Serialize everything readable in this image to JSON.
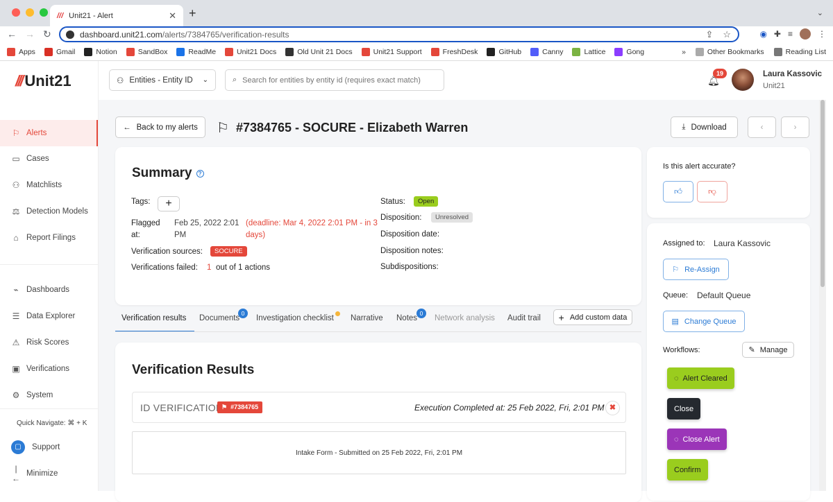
{
  "browser": {
    "tab_title": "Unit21 - Alert",
    "url_host": "dashboard.unit21.com",
    "url_path": "/alerts/7384765/verification-results",
    "bookmarks": [
      {
        "label": "Apps",
        "icon": "apps-grid-icon",
        "color": "#e4473a"
      },
      {
        "label": "Gmail",
        "icon": "gmail-icon",
        "color": "#d93025"
      },
      {
        "label": "Notion",
        "icon": "notion-icon",
        "color": "#222222"
      },
      {
        "label": "SandBox",
        "icon": "unit21-icon",
        "color": "#e4473a"
      },
      {
        "label": "ReadMe",
        "icon": "readme-icon",
        "color": "#1a73e8"
      },
      {
        "label": "Unit21 Docs",
        "icon": "unit21-icon",
        "color": "#e4473a"
      },
      {
        "label": "Old Unit 21 Docs",
        "icon": "globe-icon",
        "color": "#333333"
      },
      {
        "label": "Unit21 Support",
        "icon": "unit21-icon",
        "color": "#e4473a"
      },
      {
        "label": "FreshDesk",
        "icon": "unit21-icon",
        "color": "#e4473a"
      },
      {
        "label": "GitHub",
        "icon": "github-icon",
        "color": "#222222"
      },
      {
        "label": "Canny",
        "icon": "canny-icon",
        "color": "#525df9"
      },
      {
        "label": "Lattice",
        "icon": "lattice-icon",
        "color": "#7bb342"
      },
      {
        "label": "Gong",
        "icon": "gong-icon",
        "color": "#8b3dff"
      }
    ],
    "bookmarks_more": "»",
    "other_bookmarks": "Other Bookmarks",
    "reading_list": "Reading List"
  },
  "sidebar": {
    "logo": "Unit21",
    "items": [
      {
        "label": "Alerts",
        "icon": "flag-icon",
        "glyph": "⚐",
        "active": true
      },
      {
        "label": "Cases",
        "icon": "briefcase-icon",
        "glyph": "▭",
        "active": false
      },
      {
        "label": "Matchlists",
        "icon": "person-add-icon",
        "glyph": "⚇",
        "active": false
      },
      {
        "label": "Detection Models",
        "icon": "scale-icon",
        "glyph": "⚖",
        "active": false
      },
      {
        "label": "Report Filings",
        "icon": "bank-icon",
        "glyph": "⌂",
        "active": false
      },
      {
        "label": "Dashboards",
        "icon": "chart-line-icon",
        "glyph": "⌁",
        "active": false
      },
      {
        "label": "Data Explorer",
        "icon": "data-search-icon",
        "glyph": "☰",
        "active": false
      },
      {
        "label": "Risk Scores",
        "icon": "warning-icon",
        "glyph": "⚠",
        "active": false
      },
      {
        "label": "Verifications",
        "icon": "id-card-icon",
        "glyph": "▣",
        "active": false
      },
      {
        "label": "System",
        "icon": "gear-icon",
        "glyph": "⚙",
        "active": false
      }
    ],
    "quick_navigate": "Quick Navigate: ⌘ + K",
    "support": "Support",
    "minimize": "Minimize"
  },
  "header": {
    "entity_select": "Entities - Entity ID",
    "search_placeholder": "Search for entities by entity id (requires exact match)",
    "notifications": "19",
    "user_name": "Laura Kassovic",
    "user_org": "Unit21"
  },
  "page": {
    "back": "Back to my alerts",
    "title": "#7384765 - SOCURE - Elizabeth Warren",
    "download": "Download"
  },
  "summary": {
    "title": "Summary",
    "tags_label": "Tags:",
    "flagged_label_1": "Flagged",
    "flagged_label_2": "at:",
    "flagged_value_1": "Feb 25, 2022 2:01",
    "flagged_value_2": "PM",
    "deadline_1": "(deadline: Mar 4, 2022 2:01 PM - in 3",
    "deadline_2": "days)",
    "sources_label": "Verification sources:",
    "source": "SOCURE",
    "failed_label": "Verifications failed:",
    "failed_count": "1",
    "failed_suffix": "out of 1 actions",
    "status_label": "Status:",
    "status": "Open",
    "disposition_label": "Disposition:",
    "disposition": "Unresolved",
    "disposition_date_label": "Disposition date:",
    "disposition_notes_label": "Disposition notes:",
    "subdispositions_label": "Subdispositions:"
  },
  "tabs": {
    "verification_results": "Verification results",
    "documents": "Documents",
    "documents_count": "0",
    "investigation_checklist": "Investigation checklist",
    "narrative": "Narrative",
    "notes": "Notes",
    "notes_count": "0",
    "network_analysis": "Network analysis",
    "audit_trail": "Audit trail",
    "add_custom_data": "Add custom data"
  },
  "verification": {
    "title": "Verification Results",
    "section": "ID VERIFICATION",
    "alert_tag": "#7384765",
    "executed": "Execution Completed at: 25 Feb 2022, Fri, 2:01 PM",
    "intake": "Intake Form - Submitted on 25 Feb 2022, Fri, 2:01 PM"
  },
  "right_panel": {
    "accuracy_question": "Is this alert accurate?",
    "assigned_label": "Assigned to:",
    "assigned_value": "Laura Kassovic",
    "reassign": "Re-Assign",
    "queue_label": "Queue:",
    "queue_value": "Default Queue",
    "change_queue": "Change Queue",
    "workflows_label": "Workflows:",
    "manage": "Manage",
    "workflows": [
      {
        "label": "Alert Cleared",
        "color": "#9acd1e",
        "text_color": "#222222",
        "icon": "check-circle-icon"
      },
      {
        "label": "Close",
        "color": "#25292f",
        "text_color": "#ffffff",
        "icon": ""
      },
      {
        "label": "Close Alert",
        "color": "#9b35b8",
        "text_color": "#ffffff",
        "icon": "check-circle-icon"
      },
      {
        "label": "Confirm",
        "color": "#9acd1e",
        "text_color": "#222222",
        "icon": ""
      }
    ]
  },
  "colors": {
    "brand": "#e4473a",
    "accent_blue": "#2b7bd5",
    "status_open": "#9acd1e",
    "page_bg": "#f5f6f8"
  }
}
